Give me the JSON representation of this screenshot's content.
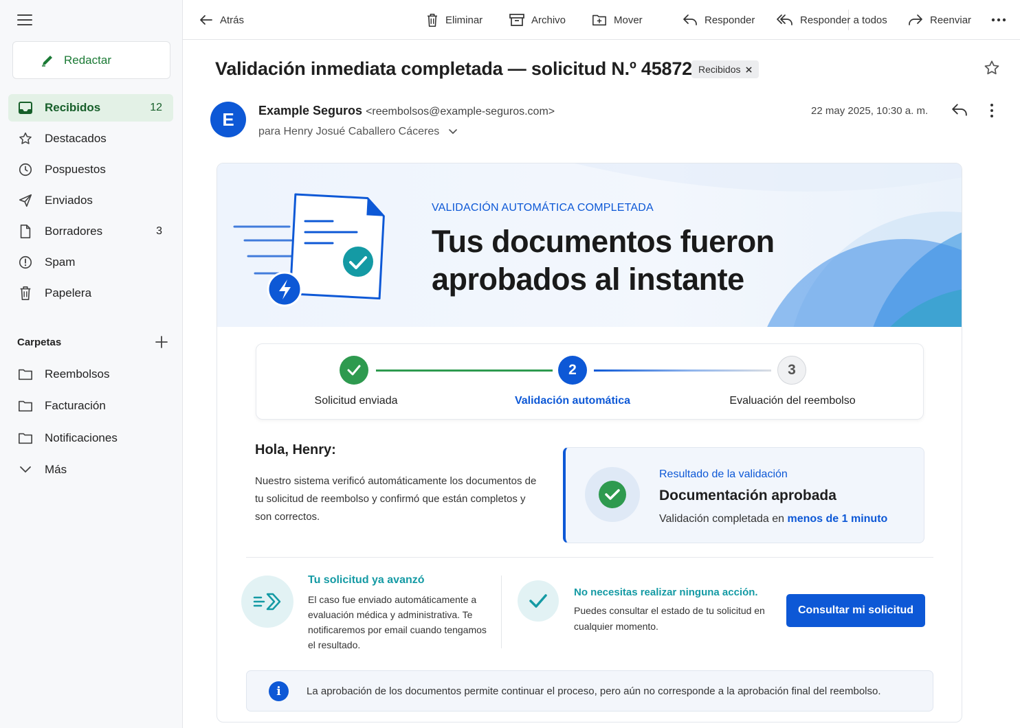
{
  "sidebar": {
    "compose_label": "Redactar",
    "items": [
      {
        "label": "Recibidos",
        "count": "12",
        "icon": "inbox-icon"
      },
      {
        "label": "Destacados",
        "count": "",
        "icon": "star-icon"
      },
      {
        "label": "Pospuestos",
        "count": "",
        "icon": "clock-icon"
      },
      {
        "label": "Enviados",
        "count": "",
        "icon": "send-icon"
      },
      {
        "label": "Borradores",
        "count": "3",
        "icon": "draft-icon"
      },
      {
        "label": "Spam",
        "count": "",
        "icon": "spam-icon"
      },
      {
        "label": "Papelera",
        "count": "",
        "icon": "trash-icon"
      }
    ],
    "folders_heading": "Carpetas",
    "folders": [
      {
        "label": "Reembolsos"
      },
      {
        "label": "Facturación"
      },
      {
        "label": "Notificaciones"
      }
    ],
    "more_label": "Más"
  },
  "toolbar": {
    "back": "Atrás",
    "delete": "Eliminar",
    "archive": "Archivo",
    "move": "Mover",
    "reply": "Responder",
    "reply_all": "Responder a todos",
    "forward": "Reenviar"
  },
  "message": {
    "subject": "Validación inmediata completada — solicitud N.º 45872",
    "label_chip": "Recibidos",
    "avatar_letter": "E",
    "sender_name": "Example Seguros",
    "sender_email": "<reembolsos@example-seguros.com>",
    "to_prefix": "para",
    "to_name": "Henry Josué Caballero Cáceres",
    "date": "22 may 2025, 10:30 a. m."
  },
  "email": {
    "hero_kicker": "VALIDACIÓN AUTOMÁTICA COMPLETADA",
    "hero_title": "Tus documentos fueron aprobados al instante",
    "steps": [
      {
        "label": "Solicitud enviada",
        "state": "done"
      },
      {
        "number": "2",
        "label": "Validación automática",
        "state": "current"
      },
      {
        "number": "3",
        "label": "Evaluación del reembolso",
        "state": "pending"
      }
    ],
    "greeting": "Hola, Henry:",
    "body": "Nuestro sistema verificó automáticamente los documentos de tu solicitud de reembolso y confirmó que están completos y son correctos.",
    "result_kicker": "Resultado de la validación",
    "result_title": "Documentación aprobada",
    "result_sub": "Validación completada en",
    "result_sub_highlight": "menos de 1 minuto",
    "feature1_title": "Tu solicitud ya avanzó",
    "feature1_text": "El caso fue enviado automáticamente a evaluación médica y administrativa. Te notificaremos por email cuando tengamos el resultado.",
    "feature2_title": "No necesitas realizar ninguna acción.",
    "feature2_text": "Puedes consultar el estado de tu solicitud en cualquier momento.",
    "cta": "Consultar mi solicitud",
    "info_icon": "i",
    "info_text": "La aprobación de los documentos permite continuar el proceso, pero aún no corresponde a la aprobación final del reembolso."
  },
  "colors": {
    "brand_blue": "#0d58d6",
    "success_green": "#2e9a4f",
    "teal": "#149aa4",
    "active_nav_bg": "#e3f1e6"
  }
}
